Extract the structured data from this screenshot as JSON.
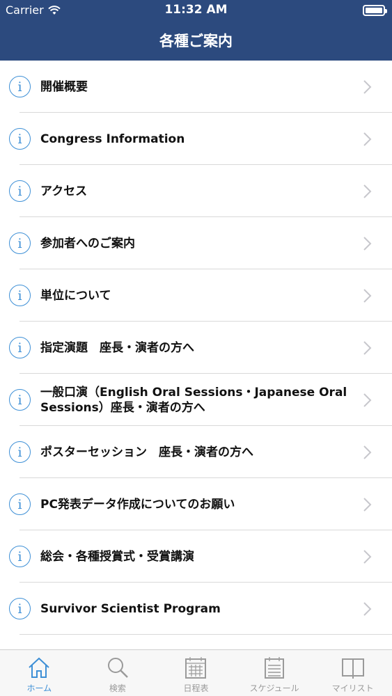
{
  "status": {
    "carrier": "Carrier",
    "time": "11:32 AM"
  },
  "nav": {
    "title": "各種ご案内"
  },
  "list": {
    "items": [
      {
        "label": "開催概要"
      },
      {
        "label": "Congress Information"
      },
      {
        "label": "アクセス"
      },
      {
        "label": "参加者へのご案内"
      },
      {
        "label": "単位について"
      },
      {
        "label": "指定演題　座長・演者の方へ"
      },
      {
        "label": "一般口演（English Oral Sessions・Japanese Oral Sessions）座長・演者の方へ"
      },
      {
        "label": "ポスターセッション　座長・演者の方へ"
      },
      {
        "label": "PC発表データ作成についてのお願い"
      },
      {
        "label": "総会・各種授賞式・受賞講演"
      },
      {
        "label": "Survivor Scientist Program"
      }
    ]
  },
  "tabs": [
    {
      "label": "ホーム",
      "icon": "home-icon",
      "active": true
    },
    {
      "label": "検索",
      "icon": "search-icon"
    },
    {
      "label": "日程表",
      "icon": "calendar-icon"
    },
    {
      "label": "スケジュール",
      "icon": "schedule-icon"
    },
    {
      "label": "マイリスト",
      "icon": "book-icon"
    }
  ],
  "colors": {
    "header": "#2c4a7e",
    "accent": "#3d8fd6",
    "inactive": "#9a9a9a"
  }
}
